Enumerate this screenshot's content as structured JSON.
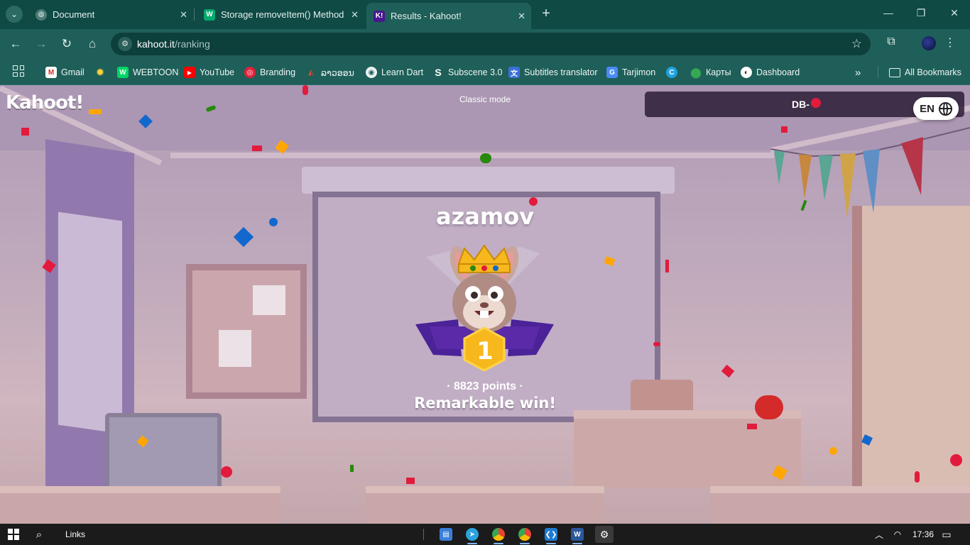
{
  "browser": {
    "tabs": [
      {
        "title": "Document",
        "favicon": "globe-icon",
        "active": false
      },
      {
        "title": "Storage removeItem() Method",
        "favicon": "w3schools-icon",
        "active": false
      },
      {
        "title": "Results - Kahoot!",
        "favicon": "kahoot-icon",
        "active": true
      }
    ],
    "address": {
      "host": "kahoot.it",
      "path": "/ranking"
    },
    "bookmarks": [
      {
        "label": "Gmail",
        "icon": "gmail-icon"
      },
      {
        "label": "",
        "icon": "sun-icon"
      },
      {
        "label": "WEBTOON",
        "icon": "webtoon-icon"
      },
      {
        "label": "YouTube",
        "icon": "youtube-icon"
      },
      {
        "label": "Branding",
        "icon": "branding-icon"
      },
      {
        "label": "ລາວອອນ",
        "icon": "watermelon-icon"
      },
      {
        "label": "Learn Dart",
        "icon": "dart-icon"
      },
      {
        "label": "Subscene 3.0",
        "icon": "subscene-icon"
      },
      {
        "label": "Subtitles translator",
        "icon": "translator-icon"
      },
      {
        "label": "Tarjimon",
        "icon": "tarjimon-icon"
      },
      {
        "label": "",
        "icon": "canva-icon"
      },
      {
        "label": "Карты",
        "icon": "maps-icon"
      },
      {
        "label": "Dashboard",
        "icon": "github-icon"
      }
    ],
    "all_bookmarks_label": "All Bookmarks",
    "more_bookmarks": "»"
  },
  "page": {
    "logo": "Kahoot!",
    "mode": "Classic mode",
    "pin_label": "DB-",
    "language": "EN",
    "winner": {
      "name": "azamov",
      "rank": "1",
      "points": "· 8823 points ·",
      "subtitle": "Remarkable win!"
    },
    "colors": {
      "gold": "#f6b81c",
      "purple": "#4b2297",
      "accent": "#46178f"
    }
  },
  "taskbar": {
    "search_label": "Links",
    "time": "17:36",
    "apps": [
      "file-explorer-icon",
      "telegram-icon",
      "chrome-icon",
      "chrome-profile-icon",
      "vscode-icon",
      "word-icon",
      "settings-icon"
    ]
  }
}
